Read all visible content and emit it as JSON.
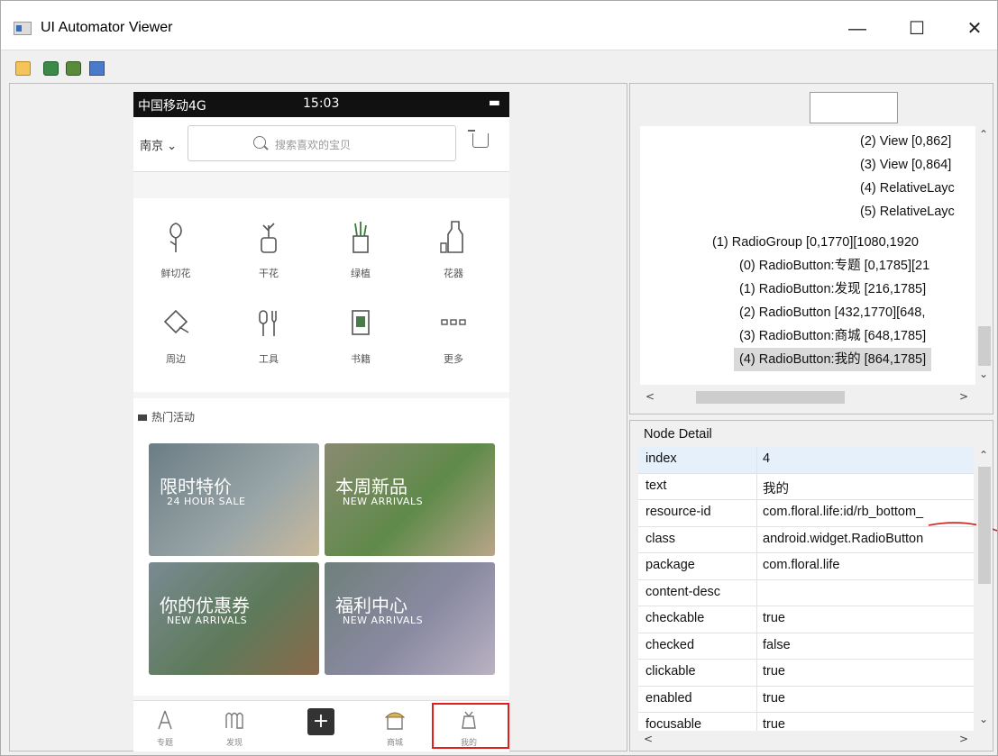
{
  "window": {
    "title": "UI Automator Viewer",
    "minimize": "—",
    "maximize": "☐",
    "close": "✕"
  },
  "phone": {
    "status_left": "中国移动4G",
    "status_time": "15:03",
    "city": "南京",
    "search_placeholder": "搜索喜欢的宝贝",
    "categories": [
      "鲜切花",
      "干花",
      "绿植",
      "花器",
      "周边",
      "工具",
      "书籍",
      "更多"
    ],
    "section_title": "热门活动",
    "banners": [
      {
        "title": "限时特价",
        "subtitle": "24 HOUR SALE"
      },
      {
        "title": "本周新品",
        "subtitle": "NEW ARRIVALS"
      },
      {
        "title": "你的优惠券",
        "subtitle": "NEW ARRIVALS"
      },
      {
        "title": "福利中心",
        "subtitle": "NEW ARRIVALS"
      }
    ],
    "nav": [
      "专题",
      "发现",
      "",
      "商城",
      "我的"
    ]
  },
  "tree": {
    "rows": [
      "(2) View [0,862]",
      "(3) View [0,864]",
      "(4) RelativeLayc",
      "(5) RelativeLayc",
      "(1) RadioGroup [0,1770][1080,1920",
      "(0) RadioButton:专题 [0,1785][21",
      "(1) RadioButton:发现 [216,1785]",
      "(2) RadioButton [432,1770][648,",
      "(3) RadioButton:商城 [648,1785]",
      "(4) RadioButton:我的 [864,1785]"
    ]
  },
  "detail": {
    "title": "Node Detail",
    "rows": [
      {
        "key": "index",
        "value": "4"
      },
      {
        "key": "text",
        "value": "我的"
      },
      {
        "key": "resource-id",
        "value": "com.floral.life:id/rb_bottom_"
      },
      {
        "key": "class",
        "value": "android.widget.RadioButton"
      },
      {
        "key": "package",
        "value": "com.floral.life"
      },
      {
        "key": "content-desc",
        "value": ""
      },
      {
        "key": "checkable",
        "value": "true"
      },
      {
        "key": "checked",
        "value": "false"
      },
      {
        "key": "clickable",
        "value": "true"
      },
      {
        "key": "enabled",
        "value": "true"
      },
      {
        "key": "focusable",
        "value": "true"
      }
    ]
  },
  "colors": {
    "selection": "#d9d9d9",
    "highlight": "#e02020",
    "header_bg": "#ffffff"
  }
}
